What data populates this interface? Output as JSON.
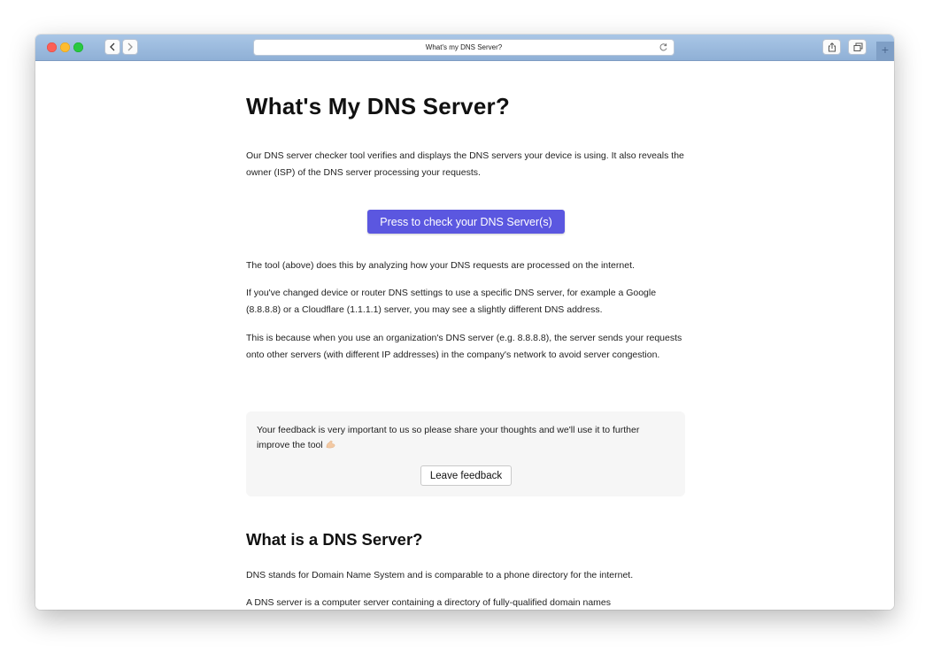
{
  "browser": {
    "url_title": "What's my DNS Server?",
    "new_tab_symbol": "+"
  },
  "page": {
    "title": "What's My DNS Server?",
    "intro": "Our DNS server checker tool verifies and displays the DNS servers your device is using. It also reveals the owner (ISP) of the DNS server processing your requests.",
    "check_button": "Press to check your DNS Server(s)",
    "paragraph_1": "The tool (above) does this by analyzing how your DNS requests are processed on the internet.",
    "paragraph_2": "If you've changed device or router DNS settings to use a specific DNS server, for example a Google (8.8.8.8) or a Cloudflare (1.1.1.1) server, you may see a slightly different DNS address.",
    "paragraph_3": "This is because when you use an organization's DNS server (e.g. 8.8.8.8), the server sends your requests onto other servers (with different IP addresses) in the company's network to avoid server congestion.",
    "feedback": {
      "text": "Your feedback is very important to us so please share your thoughts and we'll use it to further improve the tool",
      "button": "Leave feedback"
    },
    "section_title": "What is a DNS Server?",
    "section_p1": "DNS stands for Domain Name System and is comparable to a phone directory for the internet.",
    "section_p2": "A DNS server is a computer server containing a directory of fully-qualified domain names"
  },
  "colors": {
    "accent": "#5b57e0",
    "toolbar": "#9ebbdf"
  }
}
